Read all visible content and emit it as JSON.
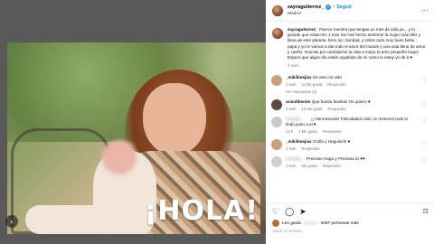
{
  "header": {
    "username": "zayragutierrez_",
    "follow": "Seguir",
    "location": "Madrid",
    "more": "···"
  },
  "caption": {
    "username": "zayragutierrez_",
    "text": "Parece mentira que tengas un mes de vida ya... y lo grande que estas! En 1 mes me has hecho sentirme la mujer más feliz y llena de este planeta. Eres luz, bondad, y sobre todo muy buen bebe... papa y yo te vamos a dar todo el amor del mundo y una vida llena de amor y cariño. Gracias por cambiarme la vida a mejor te amo pequeño hugo! Espero que algún día estés orgulloso de mi como lo estoy yo de ti ♥",
    "time": "4 sem"
  },
  "comments": [
    {
      "user": "_mikilimejias",
      "text": "Os amo mi vida",
      "time": "11 Me gusta",
      "likes": "Responder",
      "extra": "4 sem",
      "replies": "Ver respuestas (5)",
      "avatar": "#c9a07e"
    },
    {
      "user": "arandibenito",
      "text": "Que bonita familia!! Os quiero ♥",
      "time": "4 sem",
      "likes": "10 Me gusta",
      "extra": "Responder",
      "replies": "",
      "avatar": "#5e4a40"
    },
    {
      "user": "",
      "text": "¡¡ Hermosooss! Felicidades cielo, te mereces todo lo lindo junto a el ♥",
      "time": "14 h",
      "likes": "3 Me gusta",
      "extra": "Responder",
      "replies": "",
      "avatar": "#c8c8c8"
    },
    {
      "user": "_mikilimejias",
      "text": "Chiña y Huguinchi ♥",
      "time": "4 sem",
      "likes": "Responder",
      "extra": "",
      "replies": "",
      "avatar": "#c9a07e"
    },
    {
      "user": "",
      "text": "Precioso Hugo y Preciosa tú ♥♥",
      "time": "4 sem",
      "likes": "Me gusta",
      "extra": "Responder",
      "replies": "",
      "avatar": "#d0d0d0"
    }
  ],
  "footer": {
    "likes_prefix": "Les gusta",
    "likes_count": "2067 personas más",
    "date": "HACE 12 HORAS"
  },
  "media": {
    "brand": "¡HOLA!"
  }
}
